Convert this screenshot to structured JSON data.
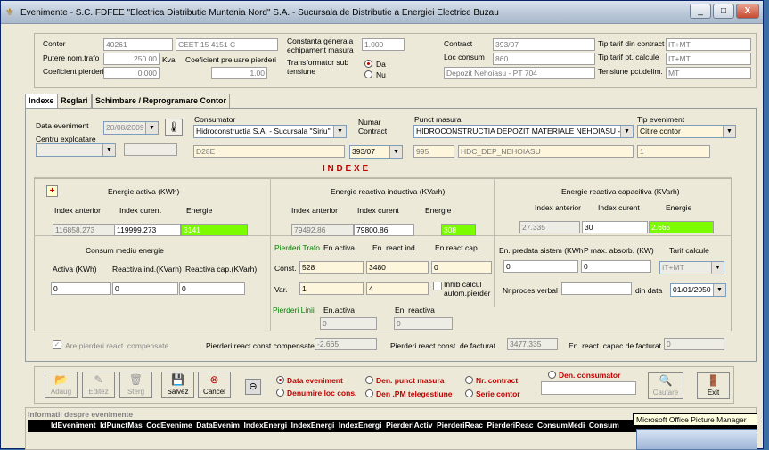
{
  "window": {
    "title": "Evenimente - S.C. FDFEE \"Electrica Distributie Muntenia Nord\" S.A. - Sucursala de Distributie a Energiei Electrice Buzau",
    "minimize": "_",
    "maximize": "□",
    "close": "X"
  },
  "header": {
    "contor_label": "Contor",
    "contor_value": "40261",
    "contor_type": "CEET 15 4151 C",
    "putere_label": "Putere nom.trafo",
    "putere_value": "250.00",
    "putere_unit": "Kva",
    "coef_pierderi_label": "Coeficient pierderi",
    "coef_pierderi_value": "0.000",
    "coef_preluare_label": "Coeficient preluare pierderi",
    "coef_preluare_value": "1.00",
    "constanta_label": "Constanta generala echipament masura",
    "constanta_value": "1.000",
    "transformator_label": "Transformator sub tensiune",
    "radio_da": "Da",
    "radio_nu": "Nu",
    "contract_label": "Contract",
    "contract_value": "393/07",
    "loc_consum_label": "Loc consum",
    "loc_consum_value": "860",
    "loc_consum_desc": "Depozit Nehoiasu - PT 704",
    "tip_tarif_contract_label": "Tip tarif din contract",
    "tip_tarif_contract_value": "IT+MT",
    "tip_tarif_calcul_label": "Tip tarif pt. calcule",
    "tip_tarif_calcul_value": "IT+MT",
    "tensiune_label": "Tensiune pct.delim.",
    "tensiune_value": "MT"
  },
  "tabs": [
    "Indexe",
    "Reglari",
    "Schimbare / Reprogramare Contor"
  ],
  "event": {
    "data_label": "Data eveniment",
    "data_value": "20/08/2009",
    "centru_label": "Centru exploatare",
    "consumator_label": "Consumator",
    "consumator_value": "Hidroconstructia S.A. - Sucursala \"Siriu\"",
    "consumator_code": "D28E",
    "numar_contract_label": "Numar Contract",
    "numar_contract_value": "393/07",
    "punct_label": "Punct masura",
    "punct_value": "HIDROCONSTRUCTIA DEPOZIT MATERIALE NEHOIASU - PT",
    "punct_code": "995",
    "punct_name": "HDC_DEP_NEHOIASU",
    "tip_label": "Tip eveniment",
    "tip_value": "Citire contor",
    "tip_code": "1"
  },
  "indexe": {
    "title": "I N D E X E",
    "plus": "+",
    "activa_title": "Energie activa (KWh)",
    "col_index_anterior": "Index anterior",
    "col_index_curent": "Index curent",
    "col_energie": "Energie",
    "activa_anterior": "116858.273",
    "activa_curent": "119999.273",
    "activa_energie": "3141",
    "inductiva_title": "Energie reactiva inductiva (KVarh)",
    "inductiva_anterior": "79492.86",
    "inductiva_curent": "79800.86",
    "inductiva_energie": "308",
    "capacitiva_title": "Energie reactiva capacitiva (KVarh)",
    "capacitiva_anterior": "27.335",
    "capacitiva_curent": "30",
    "capacitiva_energie": "2.665",
    "consum_title": "Consum mediu energie",
    "consum_activa_label": "Activa (KWh)",
    "consum_react_ind_label": "Reactiva ind.(KVarh)",
    "consum_react_cap_label": "Reactiva cap.(KVarh)",
    "consum_activa": "0",
    "consum_react_ind": "0",
    "consum_react_cap": "0",
    "pierderi_trafo_label": "Pierderi Trafo",
    "pt_en_activa": "En.activa",
    "pt_en_react_ind": "En. react.ind.",
    "pt_en_react_cap": "En.react.cap.",
    "const_label": "Const.",
    "const_activa": "528",
    "const_ind": "3480",
    "const_cap": "0",
    "var_label": "Var.",
    "var_activa": "1",
    "var_ind": "4",
    "inhib_label": "Inhib calcul autom.pierder",
    "pierderi_linii_label": "Pierderi Linii",
    "pl_en_activa": "En.activa",
    "pl_en_reactiva": "En. reactiva",
    "pl_activa": "0",
    "pl_reactiva": "0",
    "en_predata_label": "En. predata sistem (KWh",
    "p_max_label": "P max. absorb. (KW)",
    "tarif_label": "Tarif calcule",
    "en_predata": "0",
    "p_max": "0",
    "tarif_value": "IT+MT",
    "nr_proces_label": "Nr.proces verbal",
    "din_data_label": "din data",
    "din_data_value": "01/01/2050",
    "are_pierderi_label": "Are pierderi react. compensate",
    "pierderi_comp_label": "Pierderi react.const.compensate",
    "pierderi_comp_value": "-2.665",
    "pierderi_fact_label": "Pierderi react.const. de facturat",
    "pierderi_fact_value": "3477.335",
    "en_capac_label": "En. react. capac.de  facturat",
    "en_capac_value": "0"
  },
  "toolbar": {
    "adaug": "Adaug",
    "editez": "Editez",
    "sterg": "Sterg",
    "salvez": "Salvez",
    "cancel": "Cancel",
    "radio_data": "Data eveniment",
    "radio_denumire": "Denumire  loc cons.",
    "radio_den_punct": "Den. punct masura",
    "radio_den_pm": "Den .PM telegestiune",
    "radio_nr_contract": "Nr. contract",
    "radio_serie": "Serie contor",
    "radio_den_consumator": "Den. consumator",
    "cautare": "Cautare",
    "exit": "Exit"
  },
  "info": {
    "title": "Informatii despre evenimente",
    "columns": [
      "IdEveniment",
      "IdPunctMas",
      "CodEvenime",
      "DataEvenim",
      "IndexEnergi",
      "IndexEnergi",
      "IndexEnergi",
      "PierderiActiv",
      "PierderiReac",
      "PierderiReac",
      "ConsumMedi",
      "Consum"
    ]
  },
  "tooltip": "Microsoft Office Picture Manager"
}
